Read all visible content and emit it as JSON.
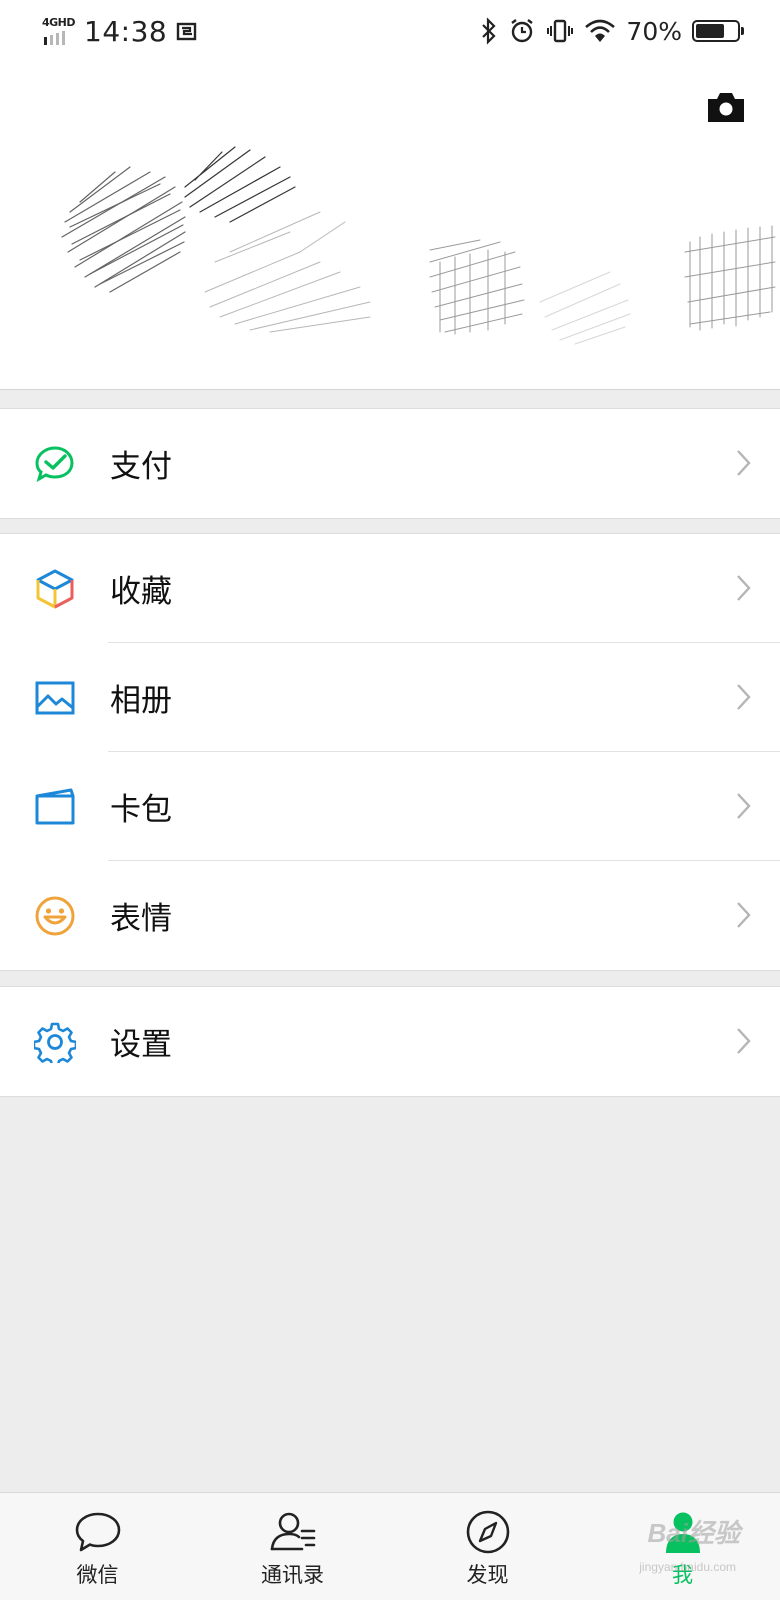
{
  "status_bar": {
    "network": "4GHD",
    "time": "14:38",
    "battery_percent": "70%",
    "battery_level": 0.7,
    "icons": [
      "screenshot-icon",
      "bluetooth-icon",
      "alarm-icon",
      "vibrate-icon",
      "wifi-icon",
      "battery-icon"
    ]
  },
  "cover": {
    "camera_icon": "camera-icon"
  },
  "menu": {
    "pay": {
      "label": "支付",
      "icon": "wechat-pay-icon",
      "color": "#07c160"
    },
    "favorites": {
      "label": "收藏",
      "icon": "cube-icon"
    },
    "album": {
      "label": "相册",
      "icon": "photo-icon",
      "color": "#1d87d8"
    },
    "cards": {
      "label": "卡包",
      "icon": "card-icon",
      "color": "#1d87d8"
    },
    "stickers": {
      "label": "表情",
      "icon": "smiley-icon",
      "color": "#f0a23b"
    },
    "settings": {
      "label": "设置",
      "icon": "gear-icon",
      "color": "#1d87d8"
    }
  },
  "tabbar": {
    "tabs": [
      {
        "label": "微信",
        "icon": "chat-bubble-icon"
      },
      {
        "label": "通讯录",
        "icon": "contacts-icon"
      },
      {
        "label": "发现",
        "icon": "compass-icon"
      },
      {
        "label": "我",
        "icon": "person-icon",
        "active": true
      }
    ],
    "active_color": "#07c160"
  },
  "watermark": {
    "text": "Bai经验",
    "sub": "jingyan.baidu.com"
  }
}
